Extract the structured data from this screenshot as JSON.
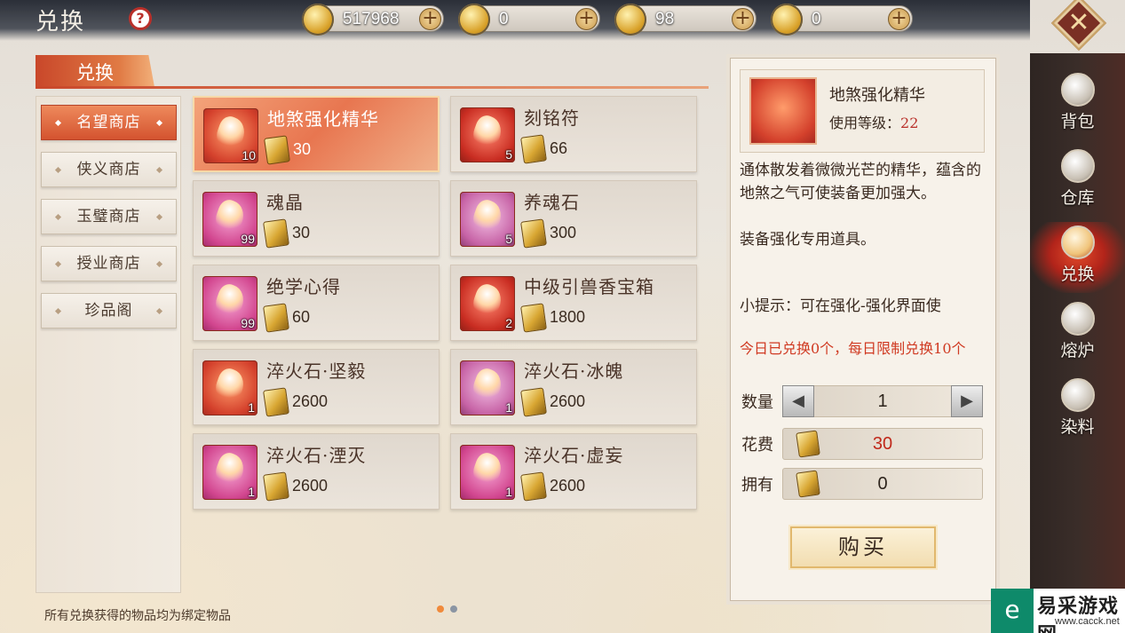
{
  "header": {
    "title": "兑换",
    "help_icon": "?"
  },
  "currencies": [
    {
      "icon": "copper-coin-icon",
      "value": "517968"
    },
    {
      "icon": "gold-coin-icon",
      "value": "0"
    },
    {
      "icon": "bound-ingot-icon",
      "value": "98"
    },
    {
      "icon": "gold-ingot-icon",
      "value": "0"
    }
  ],
  "close_icon": "✕",
  "side_nav": [
    {
      "label": "背包",
      "icon": "bag-icon",
      "active": false
    },
    {
      "label": "仓库",
      "icon": "warehouse-icon",
      "active": false
    },
    {
      "label": "兑换",
      "icon": "exchange-icon",
      "active": true
    },
    {
      "label": "熔炉",
      "icon": "furnace-icon",
      "active": false
    },
    {
      "label": "染料",
      "icon": "dye-icon",
      "active": false
    }
  ],
  "tab": {
    "label": "兑换"
  },
  "shops": [
    {
      "label": "名望商店",
      "selected": true
    },
    {
      "label": "侠义商店",
      "selected": false
    },
    {
      "label": "玉璧商店",
      "selected": false
    },
    {
      "label": "授业商店",
      "selected": false
    },
    {
      "label": "珍品阁",
      "selected": false
    }
  ],
  "items": [
    {
      "name": "地煞强化精华",
      "qty": "10",
      "price": "30",
      "selected": true
    },
    {
      "name": "刻铭符",
      "qty": "5",
      "price": "66",
      "selected": false
    },
    {
      "name": "魂晶",
      "qty": "99",
      "price": "30",
      "selected": false
    },
    {
      "name": "养魂石",
      "qty": "5",
      "price": "300",
      "selected": false
    },
    {
      "name": "绝学心得",
      "qty": "99",
      "price": "60",
      "selected": false
    },
    {
      "name": "中级引兽香宝箱",
      "qty": "2",
      "price": "1800",
      "selected": false
    },
    {
      "name": "淬火石·坚毅",
      "qty": "1",
      "price": "2600",
      "selected": false
    },
    {
      "name": "淬火石·冰魄",
      "qty": "1",
      "price": "2600",
      "selected": false
    },
    {
      "name": "淬火石·湮灭",
      "qty": "1",
      "price": "2600",
      "selected": false
    },
    {
      "name": "淬火石·虚妄",
      "qty": "1",
      "price": "2600",
      "selected": false
    }
  ],
  "pagination": {
    "pages": 2,
    "current": 1
  },
  "footnote": "所有兑换获得的物品均为绑定物品",
  "detail": {
    "name": "地煞强化精华",
    "level_label": "使用等级：",
    "level_value": "22",
    "description": "通体散发着微微光芒的精华，蕴含的地煞之气可使装备更加强大。",
    "usage": "装备强化专用道具。",
    "hint": "小提示：可在强化-强化界面使",
    "limit": "今日已兑换0个，每日限制兑换10个",
    "quantity_label": "数量",
    "quantity_value": "1",
    "cost_label": "花费",
    "cost_value": "30",
    "owned_label": "拥有",
    "owned_value": "0",
    "buy_label": "购买"
  },
  "watermark": {
    "text": "易采游戏网",
    "url": "www.cacck.net"
  }
}
